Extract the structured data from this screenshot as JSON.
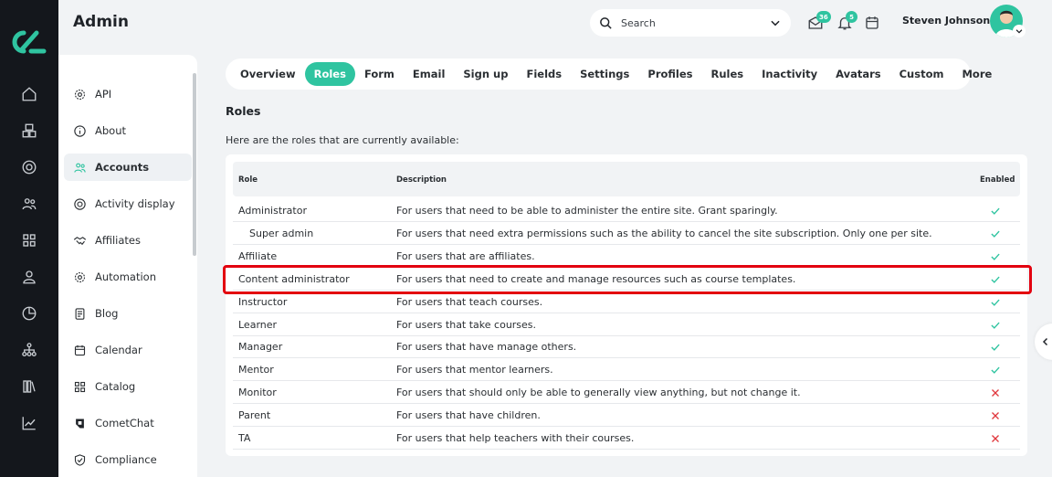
{
  "header": {
    "title": "Admin",
    "search_label": "Search",
    "messages_badge": "36",
    "notifications_badge": "5",
    "user_name": "Steven Johnson"
  },
  "sidebar": {
    "items": [
      {
        "label": "API",
        "icon": "gear-icon"
      },
      {
        "label": "About",
        "icon": "info-icon"
      },
      {
        "label": "Accounts",
        "icon": "users-icon",
        "active": true
      },
      {
        "label": "Activity display",
        "icon": "target-icon"
      },
      {
        "label": "Affiliates",
        "icon": "handshake-icon"
      },
      {
        "label": "Automation",
        "icon": "gear-icon"
      },
      {
        "label": "Blog",
        "icon": "document-icon"
      },
      {
        "label": "Calendar",
        "icon": "calendar-icon"
      },
      {
        "label": "Catalog",
        "icon": "grid-icon"
      },
      {
        "label": "CometChat",
        "icon": "cometchat-icon"
      },
      {
        "label": "Compliance",
        "icon": "shield-icon"
      }
    ]
  },
  "tabs": [
    "Overview",
    "Roles",
    "Form",
    "Email",
    "Sign up",
    "Fields",
    "Settings",
    "Profiles",
    "Rules",
    "Inactivity",
    "Avatars",
    "Custom",
    "More"
  ],
  "active_tab": "Roles",
  "section": {
    "title": "Roles",
    "intro": "Here are the roles that are currently available:"
  },
  "table": {
    "headers": {
      "role": "Role",
      "description": "Description",
      "enabled": "Enabled"
    },
    "rows": [
      {
        "role": "Administrator",
        "description": "For users that need to be able to administer the entire site. Grant sparingly.",
        "enabled": true,
        "indent": false
      },
      {
        "role": "Super admin",
        "description": "For users that need extra permissions such as the ability to cancel the site subscription. Only one per site.",
        "enabled": true,
        "indent": true
      },
      {
        "role": "Affiliate",
        "description": "For users that are affiliates.",
        "enabled": true,
        "indent": false
      },
      {
        "role": "Content administrator",
        "description": "For users that need to create and manage resources such as course templates.",
        "enabled": true,
        "indent": false
      },
      {
        "role": "Instructor",
        "description": "For users that teach courses.",
        "enabled": true,
        "indent": false
      },
      {
        "role": "Learner",
        "description": "For users that take courses.",
        "enabled": true,
        "indent": false
      },
      {
        "role": "Manager",
        "description": "For users that have manage others.",
        "enabled": true,
        "indent": false
      },
      {
        "role": "Mentor",
        "description": "For users that mentor learners.",
        "enabled": true,
        "indent": false
      },
      {
        "role": "Monitor",
        "description": "For users that should only be able to generally view anything, but not change it.",
        "enabled": false,
        "indent": false
      },
      {
        "role": "Parent",
        "description": "For users that have children.",
        "enabled": false,
        "indent": false
      },
      {
        "role": "TA",
        "description": "For users that help teachers with their courses.",
        "enabled": false,
        "indent": false
      }
    ]
  },
  "colors": {
    "accent": "#2fc4a0",
    "enabled_check": "#2fc4a0",
    "disabled_cross": "#e0363c",
    "highlight": "#e3000f",
    "rail": "#14171c"
  }
}
